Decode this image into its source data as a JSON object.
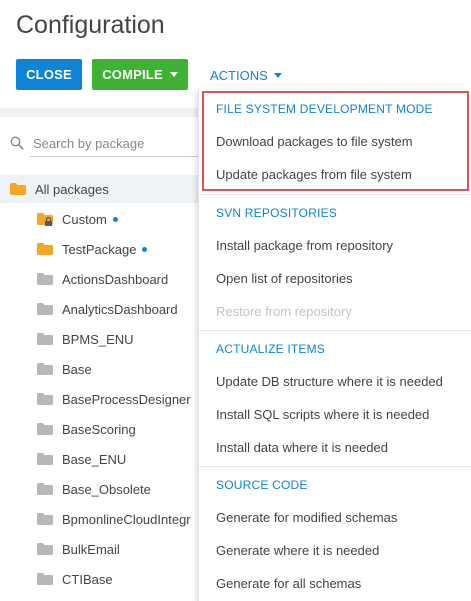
{
  "page": {
    "title": "Configuration"
  },
  "toolbar": {
    "close_label": "CLOSE",
    "compile_label": "COMPILE",
    "actions_label": "ACTIONS"
  },
  "search": {
    "placeholder": "Search by package"
  },
  "packages": {
    "root_label": "All packages",
    "items": [
      {
        "label": "Custom",
        "icon": "folder-locked-icon",
        "color": "#f5a623",
        "modified": true
      },
      {
        "label": "TestPackage",
        "icon": "folder-icon",
        "color": "#f5a623",
        "modified": true
      },
      {
        "label": "ActionsDashboard",
        "icon": "folder-icon",
        "color": "#b8b8b8",
        "modified": false
      },
      {
        "label": "AnalyticsDashboard",
        "icon": "folder-icon",
        "color": "#b8b8b8",
        "modified": false
      },
      {
        "label": "BPMS_ENU",
        "icon": "folder-icon",
        "color": "#b8b8b8",
        "modified": false
      },
      {
        "label": "Base",
        "icon": "folder-icon",
        "color": "#b8b8b8",
        "modified": false
      },
      {
        "label": "BaseProcessDesigner",
        "icon": "folder-icon",
        "color": "#b8b8b8",
        "modified": false
      },
      {
        "label": "BaseScoring",
        "icon": "folder-icon",
        "color": "#b8b8b8",
        "modified": false
      },
      {
        "label": "Base_ENU",
        "icon": "folder-icon",
        "color": "#b8b8b8",
        "modified": false
      },
      {
        "label": "Base_Obsolete",
        "icon": "folder-icon",
        "color": "#b8b8b8",
        "modified": false
      },
      {
        "label": "BpmonlineCloudIntegr",
        "icon": "folder-icon",
        "color": "#b8b8b8",
        "modified": false
      },
      {
        "label": "BulkEmail",
        "icon": "folder-icon",
        "color": "#b8b8b8",
        "modified": false
      },
      {
        "label": "CTIBase",
        "icon": "folder-icon",
        "color": "#b8b8b8",
        "modified": false
      }
    ]
  },
  "actions_menu": {
    "sections": [
      {
        "header": "FILE SYSTEM DEVELOPMENT MODE",
        "items": [
          {
            "label": "Download packages to file system",
            "enabled": true
          },
          {
            "label": "Update packages from file system",
            "enabled": true
          }
        ]
      },
      {
        "header": "SVN REPOSITORIES",
        "items": [
          {
            "label": "Install package from repository",
            "enabled": true
          },
          {
            "label": "Open list of repositories",
            "enabled": true
          },
          {
            "label": "Restore from repository",
            "enabled": false
          }
        ]
      },
      {
        "header": "ACTUALIZE ITEMS",
        "items": [
          {
            "label": "Update DB structure where it is needed",
            "enabled": true
          },
          {
            "label": "Install SQL scripts where it is needed",
            "enabled": true
          },
          {
            "label": "Install data where it is needed",
            "enabled": true
          }
        ]
      },
      {
        "header": "SOURCE CODE",
        "items": [
          {
            "label": "Generate for modified schemas",
            "enabled": true
          },
          {
            "label": "Generate where it is needed",
            "enabled": true
          },
          {
            "label": "Generate for all schemas",
            "enabled": true
          }
        ]
      }
    ]
  },
  "colors": {
    "primary_blue": "#0e84d6",
    "compile_green": "#3db233",
    "highlight_red": "#e05257",
    "folder_orange": "#f5a623",
    "folder_gray": "#b8b8b8"
  }
}
